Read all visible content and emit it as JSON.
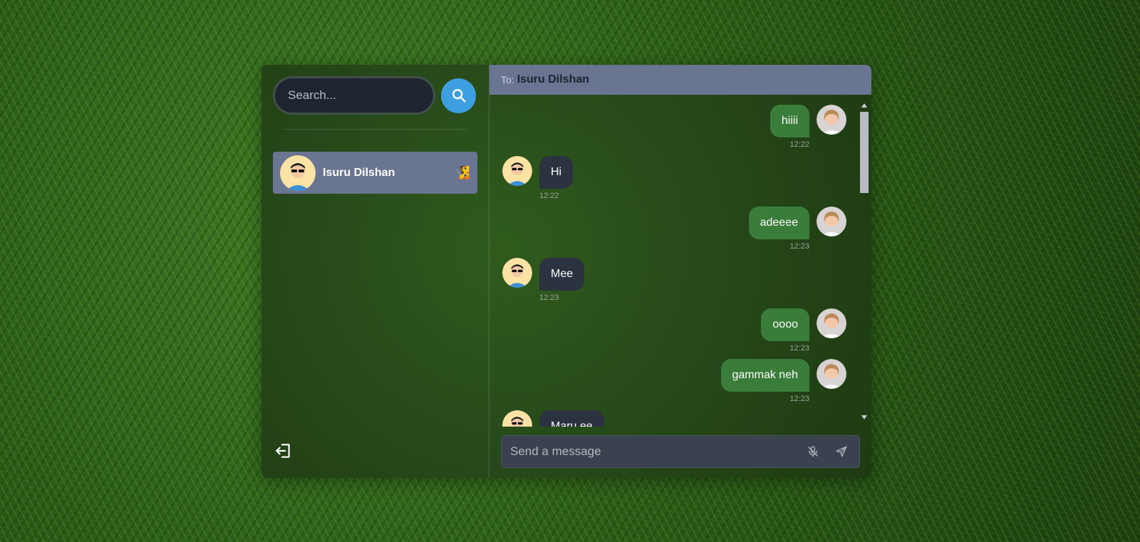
{
  "sidebar": {
    "search_placeholder": "Search...",
    "contacts": [
      {
        "name": "Isuru Dilshan",
        "status_emoji": "🧏"
      }
    ]
  },
  "chat": {
    "to_label": "To:",
    "recipient": "Isuru Dilshan",
    "messages": [
      {
        "direction": "out",
        "text": "hiiii",
        "time": "12:22"
      },
      {
        "direction": "in",
        "text": "Hi",
        "time": "12:22"
      },
      {
        "direction": "out",
        "text": "adeeee",
        "time": "12:23"
      },
      {
        "direction": "in",
        "text": "Mee",
        "time": "12:23"
      },
      {
        "direction": "out",
        "text": "oooo",
        "time": "12:23"
      },
      {
        "direction": "out",
        "text": "gammak neh",
        "time": "12:23"
      },
      {
        "direction": "in",
        "text": "Maru ee",
        "time": ""
      }
    ],
    "composer_placeholder": "Send a message"
  },
  "colors": {
    "accent_blue": "#3d9fe0",
    "outgoing_bubble": "#3a7d3a",
    "incoming_bubble": "#2b3240",
    "header_bg": "#6a7591"
  },
  "icons": [
    "search-icon",
    "logout-icon",
    "mic-off-icon",
    "send-icon"
  ]
}
